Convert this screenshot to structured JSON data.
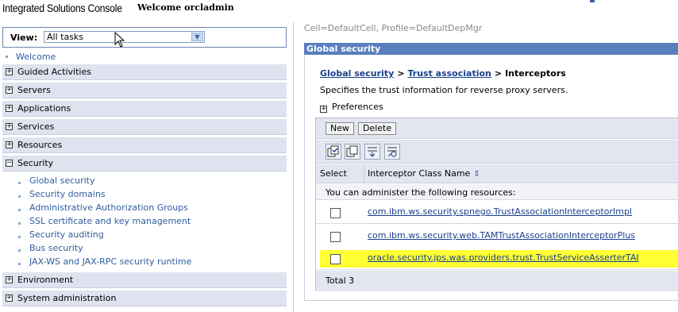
{
  "header": {
    "app_title": "Integrated Solutions Console",
    "welcome": "Welcome orcladmin"
  },
  "nav": {
    "view_label": "View:",
    "view_value": "All tasks",
    "welcome_link": "Welcome",
    "sections": [
      {
        "label": "Guided Activities",
        "toggle": "+"
      },
      {
        "label": "Servers",
        "toggle": "+"
      },
      {
        "label": "Applications",
        "toggle": "+"
      },
      {
        "label": "Services",
        "toggle": "+"
      },
      {
        "label": "Resources",
        "toggle": "+"
      },
      {
        "label": "Security",
        "toggle": "−"
      },
      {
        "label": "Environment",
        "toggle": "+"
      },
      {
        "label": "System administration",
        "toggle": "+"
      }
    ],
    "security_items": [
      "Global security",
      "Security domains",
      "Administrative Authorization Groups",
      "SSL certificate and key management",
      "Security auditing",
      "Bus security",
      "JAX-WS and JAX-RPC security runtime"
    ]
  },
  "main": {
    "cell_profile": "Cell=DefaultCell, Profile=DefaultDepMgr",
    "panel_title": "Global security",
    "breadcrumb": {
      "link1": "Global security",
      "link2": "Trust association",
      "sep": ">",
      "current": "Interceptors"
    },
    "description": "Specifies the trust information for reverse proxy servers.",
    "preferences": "Preferences",
    "buttons": {
      "new": "New",
      "delete": "Delete"
    },
    "icons": [
      "select-all-icon",
      "deselect-all-icon",
      "show-filter-icon",
      "clear-filter-icon"
    ],
    "table": {
      "col_select": "Select",
      "col_name": "Interceptor Class Name",
      "info": "You can administer the following resources:",
      "rows": [
        {
          "name": "com.ibm.ws.security.spnego.TrustAssociationInterceptorImpl",
          "highlighted": false
        },
        {
          "name": "com.ibm.ws.security.web.TAMTrustAssociationInterceptorPlus",
          "highlighted": false
        },
        {
          "name": "oracle.security.jps.was.providers.trust.TrustServiceAsserterTAI",
          "highlighted": true
        }
      ],
      "total": "Total 3"
    },
    "colors": {
      "highlight": "#ffff33",
      "panel_title_bg": "#5a7fbf",
      "link": "#1a3f8c"
    }
  }
}
